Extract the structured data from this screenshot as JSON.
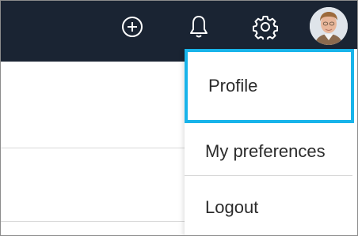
{
  "topbar": {
    "icons": {
      "add": "plus-circle-icon",
      "notifications": "bell-icon",
      "settings": "gear-icon"
    },
    "background_color": "#1a2433"
  },
  "user_menu": {
    "items": [
      {
        "label": "Profile",
        "focused": true
      },
      {
        "label": "My preferences",
        "focused": false
      },
      {
        "label": "Logout",
        "focused": false
      }
    ],
    "focus_color": "#18b4ea"
  }
}
